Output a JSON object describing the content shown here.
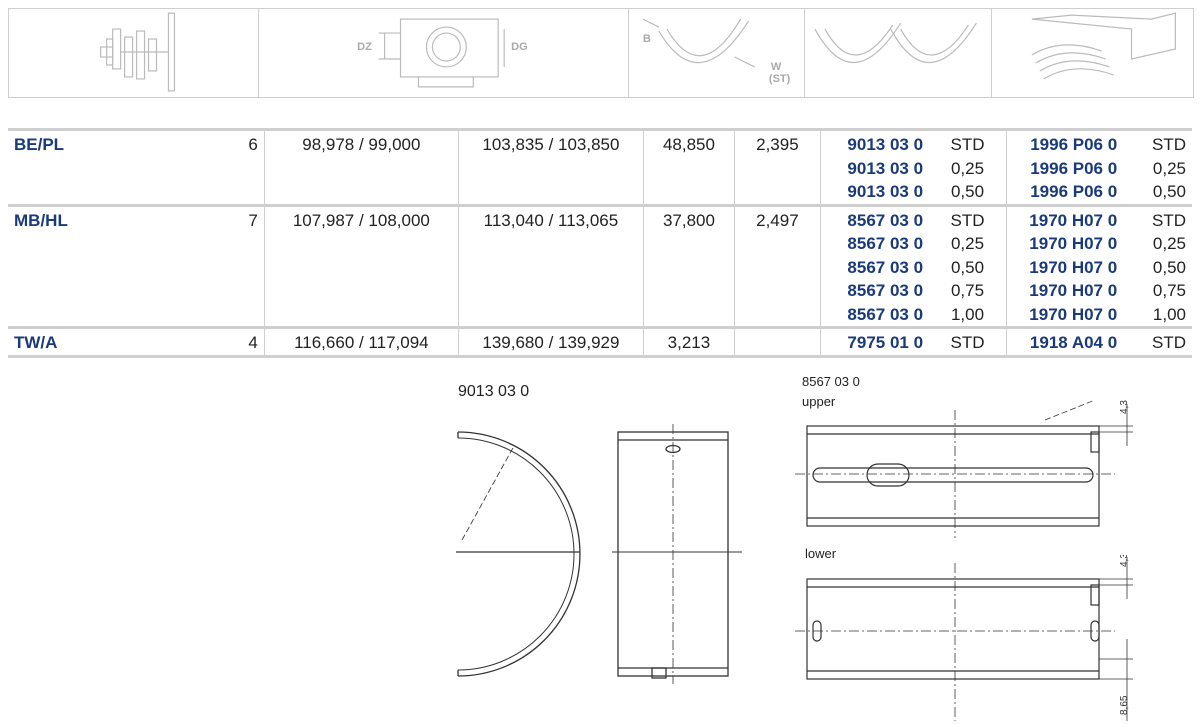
{
  "header_icons": {
    "dz_label": "DZ",
    "dg_label": "DG",
    "b_label": "B",
    "w_label": "W",
    "st_label": "(ST)"
  },
  "rows": [
    {
      "name": "BE/PL",
      "qty": "6",
      "dim1": "98,978 / 99,000",
      "dim2": "103,835 / 103,850",
      "width": "48,850",
      "thickness": "2,395",
      "part_a": [
        "9013 03 0",
        "9013 03 0",
        "9013 03 0"
      ],
      "size_a": [
        "STD",
        "0,25",
        "0,50"
      ],
      "part_b": [
        "1996 P06 0",
        "1996 P06 0",
        "1996 P06 0"
      ],
      "size_b": [
        "STD",
        "0,25",
        "0,50"
      ]
    },
    {
      "name": "MB/HL",
      "qty": "7",
      "dim1": "107,987 / 108,000",
      "dim2": "113,040 / 113,065",
      "width": "37,800",
      "thickness": "2,497",
      "part_a": [
        "8567 03 0",
        "8567 03 0",
        "8567 03 0",
        "8567 03 0",
        "8567 03 0"
      ],
      "size_a": [
        "STD",
        "0,25",
        "0,50",
        "0,75",
        "1,00"
      ],
      "part_b": [
        "1970 H07 0",
        "1970 H07 0",
        "1970 H07 0",
        "1970 H07 0",
        "1970 H07 0"
      ],
      "size_b": [
        "STD",
        "0,25",
        "0,50",
        "0,75",
        "1,00"
      ]
    },
    {
      "name": "TW/A",
      "qty": "4",
      "dim1": "116,660 / 117,094",
      "dim2": "139,680 / 139,929",
      "width": "3,213",
      "thickness": "",
      "part_a": [
        "7975 01 0"
      ],
      "size_a": [
        "STD"
      ],
      "part_b": [
        "1918 A04 0"
      ],
      "size_b": [
        "STD"
      ]
    }
  ],
  "drawings": {
    "left_title": "9013 03 0",
    "right_title": "8567 03 0",
    "upper_label": "upper",
    "lower_label": "lower",
    "dim_upper": "4,3",
    "dim_lower": "4,3",
    "dim_bottom": "8,65"
  }
}
